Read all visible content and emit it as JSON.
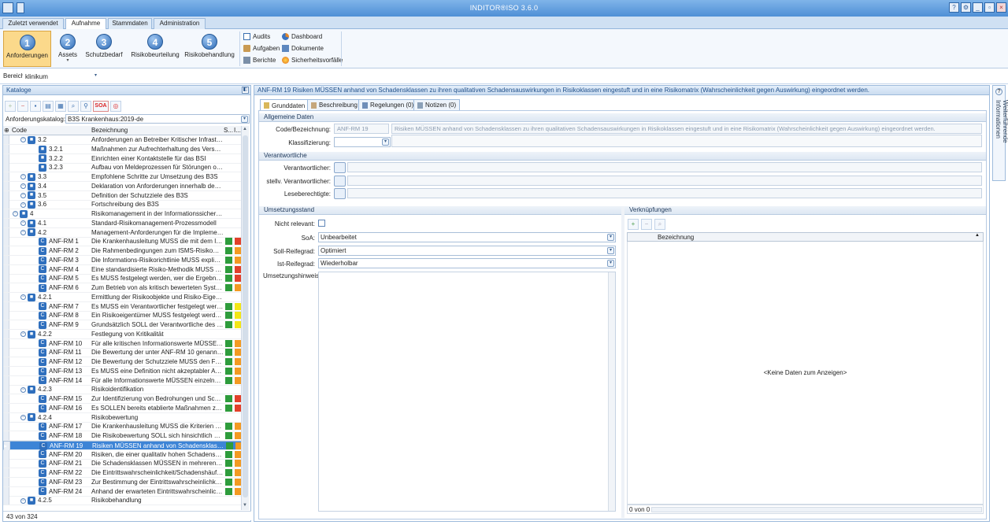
{
  "app": {
    "title": "INDITOR®ISO 3.6.0"
  },
  "colors": {
    "green": "#2e9c3c",
    "orange": "#f39a22",
    "red": "#e2402a",
    "yellow": "#f3e616",
    "accent": "#3d84d6"
  },
  "ribbon_tabs": [
    "Zuletzt verwendet",
    "Aufnahme",
    "Stammdaten",
    "Administration"
  ],
  "ribbon_steps": [
    {
      "num": "1",
      "label": "Anforderungen"
    },
    {
      "num": "2",
      "label": "Assets"
    },
    {
      "num": "3",
      "label": "Schutzbedarf"
    },
    {
      "num": "4",
      "label": "Risikobeurteilung"
    },
    {
      "num": "5",
      "label": "Risikobehandlung"
    }
  ],
  "ribbon_links": [
    "Audits",
    "Dashboard",
    "Aufgaben",
    "Dokumente",
    "Berichte",
    "Sicherheitsvorfälle"
  ],
  "bereich": {
    "label": "Bereich",
    "value": "klinikum"
  },
  "left": {
    "title": "Kataloge",
    "tool_soa": "SOA",
    "katalog_label": "Anforderungskatalog:",
    "katalog_value": "B3S Krankenhaus:2019-de",
    "col_code": "Code",
    "col_desc": "Bezeichnung",
    "col_s": "S...",
    "col_i": "I...",
    "footer": "43 von 324"
  },
  "rows": [
    {
      "code": "3.2",
      "level": 2,
      "desc": "Anforderungen an Betreiber Kritischer Infrastruk...",
      "s1": "",
      "s2": "",
      "sel": false
    },
    {
      "code": "3.2.1",
      "level": 3,
      "desc": "Maßnahmen zur Aufrechterhaltung des Versorg...",
      "s1": "",
      "s2": "",
      "sel": false
    },
    {
      "code": "3.2.2",
      "level": 3,
      "desc": "Einrichten einer Kontaktstelle für das BSI",
      "s1": "",
      "s2": "",
      "sel": false
    },
    {
      "code": "3.2.3",
      "level": 3,
      "desc": "Aufbau von Meldeprozessen für Störungen oder...",
      "s1": "",
      "s2": "",
      "sel": false
    },
    {
      "code": "3.3",
      "level": 2,
      "desc": "Empfohlene Schritte zur Umsetzung des B3S",
      "s1": "",
      "s2": "",
      "sel": false
    },
    {
      "code": "3.4",
      "level": 2,
      "desc": "Deklaration von Anforderungen innerhalb des B3S",
      "s1": "",
      "s2": "",
      "sel": false
    },
    {
      "code": "3.5",
      "level": 2,
      "desc": "Definition der Schutzziele des B3S",
      "s1": "",
      "s2": "",
      "sel": false
    },
    {
      "code": "3.6",
      "level": 2,
      "desc": "Fortschreibung des B3S",
      "s1": "",
      "s2": "",
      "sel": false
    },
    {
      "code": "4",
      "level": 1,
      "desc": "Risikomanagement in der Informationssicherheit",
      "s1": "",
      "s2": "",
      "sel": false
    },
    {
      "code": "4.1",
      "level": 2,
      "desc": "Standard-Risikomanagement-Prozessmodell",
      "s1": "",
      "s2": "",
      "sel": false
    },
    {
      "code": "4.2",
      "level": 2,
      "desc": "Management-Anforderungen für die Implemen...",
      "s1": "",
      "s2": "",
      "sel": false
    },
    {
      "code": "ANF-RM 1",
      "level": 4,
      "desc": "Die Krankenhausleitung MUSS die mit dem ISM...",
      "s1": "green",
      "s2": "red",
      "sel": false
    },
    {
      "code": "ANF-RM 2",
      "level": 4,
      "desc": "Die Rahmenbedingungen zum ISMS-Risikoman...",
      "s1": "green",
      "s2": "orange",
      "sel": false
    },
    {
      "code": "ANF-RM 3",
      "level": 4,
      "desc": "Die Informations-Risikorichtlinie MUSS explizit i...",
      "s1": "green",
      "s2": "orange",
      "sel": false
    },
    {
      "code": "ANF-RM 4",
      "level": 4,
      "desc": "Eine standardisierte Risiko-Methodik MUSS zur E...",
      "s1": "green",
      "s2": "red",
      "sel": false
    },
    {
      "code": "ANF-RM 5",
      "level": 4,
      "desc": "Es MUSS festgelegt werden, wer die Ergebnisse ...",
      "s1": "green",
      "s2": "red",
      "sel": false
    },
    {
      "code": "ANF-RM 6",
      "level": 4,
      "desc": "Zum Betrieb von als kritisch bewerteten System...",
      "s1": "green",
      "s2": "orange",
      "sel": false
    },
    {
      "code": "4.2.1",
      "level": 2,
      "desc": "Ermittlung der Risikoobjekte und Risiko-Eigentü...",
      "s1": "",
      "s2": "",
      "sel": false
    },
    {
      "code": "ANF-RM 7",
      "level": 4,
      "desc": "Es MUSS ein Verantwortlicher festgelegt werden,...",
      "s1": "green",
      "s2": "yellow",
      "sel": false
    },
    {
      "code": "ANF-RM 8",
      "level": 4,
      "desc": "Ein Risikoeigentümer MUSS festgelegt werden, ...",
      "s1": "green",
      "s2": "yellow",
      "sel": false
    },
    {
      "code": "ANF-RM 9",
      "level": 4,
      "desc": "Grundsätzlich SOLL der Verantwortliche des Info...",
      "s1": "green",
      "s2": "yellow",
      "sel": false
    },
    {
      "code": "4.2.2",
      "level": 2,
      "desc": "Festlegung von Kritikalität",
      "s1": "",
      "s2": "",
      "sel": false
    },
    {
      "code": "ANF-RM 10",
      "level": 4,
      "desc": "Für alle kritischen Informationswerte MÜSSEN di...",
      "s1": "green",
      "s2": "orange",
      "sel": false
    },
    {
      "code": "ANF-RM 11",
      "level": 4,
      "desc": "Die Bewertung der unter ANF-RM 10 genannten...",
      "s1": "green",
      "s2": "orange",
      "sel": false
    },
    {
      "code": "ANF-RM 12",
      "level": 4,
      "desc": "Die Bewertung der Schutzziele MUSS den Faktor ...",
      "s1": "green",
      "s2": "orange",
      "sel": false
    },
    {
      "code": "ANF-RM 13",
      "level": 4,
      "desc": "Es MUSS eine Definition nicht akzeptabler Auswi...",
      "s1": "green",
      "s2": "orange",
      "sel": false
    },
    {
      "code": "ANF-RM 14",
      "level": 4,
      "desc": "Für alle Informationswerte MÜSSEN einzelne Per...",
      "s1": "green",
      "s2": "orange",
      "sel": false
    },
    {
      "code": "4.2.3",
      "level": 2,
      "desc": "Risikoidentifikation",
      "s1": "",
      "s2": "",
      "sel": false
    },
    {
      "code": "ANF-RM 15",
      "level": 4,
      "desc": "Zur Identifizierung von Bedrohungen und Schw...",
      "s1": "green",
      "s2": "red",
      "sel": false
    },
    {
      "code": "ANF-RM 16",
      "level": 4,
      "desc": "Es SOLLEN bereits etablierte Maßnahmen zu de...",
      "s1": "green",
      "s2": "red",
      "sel": false
    },
    {
      "code": "4.2.4",
      "level": 2,
      "desc": "Risikobewertung",
      "s1": "",
      "s2": "",
      "sel": false
    },
    {
      "code": "ANF-RM 17",
      "level": 4,
      "desc": "Die Krankenhausleitung MUSS die Kriterien zur B...",
      "s1": "green",
      "s2": "orange",
      "sel": false
    },
    {
      "code": "ANF-RM 18",
      "level": 4,
      "desc": "Die Risikobewertung SOLL sich hinsichtlich eine...",
      "s1": "green",
      "s2": "orange",
      "sel": false
    },
    {
      "code": "ANF-RM 19",
      "level": 4,
      "desc": "Risiken MÜSSEN anhand von Schadensklassen z...",
      "s1": "green",
      "s2": "orange",
      "sel": true
    },
    {
      "code": "ANF-RM 20",
      "level": 4,
      "desc": "Risiken, die einer qualitativ hohen Schadensklas...",
      "s1": "green",
      "s2": "orange",
      "sel": false
    },
    {
      "code": "ANF-RM 21",
      "level": 4,
      "desc": "Die Schadensklassen MÜSSEN in mehreren Stufe...",
      "s1": "green",
      "s2": "orange",
      "sel": false
    },
    {
      "code": "ANF-RM 22",
      "level": 4,
      "desc": "Die Eintrittswahrscheinlichkeit/Schadenshäufigk...",
      "s1": "green",
      "s2": "orange",
      "sel": false
    },
    {
      "code": "ANF-RM 23",
      "level": 4,
      "desc": "Zur Bestimmung der Eintrittswahrscheinlichkeit...",
      "s1": "green",
      "s2": "orange",
      "sel": false
    },
    {
      "code": "ANF-RM 24",
      "level": 4,
      "desc": "Anhand der erwarteten Eintrittswahrscheinlichk...",
      "s1": "green",
      "s2": "orange",
      "sel": false
    },
    {
      "code": "4.2.5",
      "level": 2,
      "desc": "Risikobehandlung",
      "s1": "",
      "s2": "",
      "sel": false
    }
  ],
  "detail": {
    "title": "ANF-RM 19 Risiken MÜSSEN anhand von Schadensklassen zu ihren qualitativen Schadensauswirkungen in Risikoklassen eingestuft und in eine Risikomatrix (Wahrscheinlichkeit gegen Auswirkung) eingeordnet werden.",
    "tabs": [
      "Grunddaten",
      "Beschreibung",
      "Regelungen (0)",
      "Notizen (0)"
    ],
    "sec_allgemein": "Allgemeine Daten",
    "code_label": "Code/Bezeichnung:",
    "code_value": "ANF-RM 19",
    "bez_value": "Risiken MÜSSEN anhand von Schadensklassen zu ihren qualitativen Schadensauswirkungen in Risikoklassen eingestuft und in eine Risikomatrix (Wahrscheinlichkeit gegen Auswirkung) eingeordnet werden.",
    "klass_label": "Klassifizierung:",
    "sec_verantw": "Verantwortliche",
    "verantw_label": "Verantwortlicher:",
    "stellv_label": "stellv. Verantwortlicher:",
    "lese_label": "Leseberechtigte:",
    "sec_umsetzung": "Umsetzungsstand",
    "nicht_relevant": "Nicht relevant:",
    "soa_label": "SoA:",
    "soa_value": "Unbearbeitet",
    "soll_label": "Soll-Reifegrad:",
    "soll_value": "Optimiert",
    "ist_label": "Ist-Reifegrad:",
    "ist_value": "Wiederholbar",
    "hinweis_label": "Umsetzungshinweis:",
    "sec_verkn": "Verknüpfungen",
    "verkn_col": "Bezeichnung",
    "verkn_empty": "<Keine Daten zum Anzeigen>",
    "verkn_count": "0 von 0"
  },
  "side": {
    "label": "Weiterführende Informationen"
  }
}
